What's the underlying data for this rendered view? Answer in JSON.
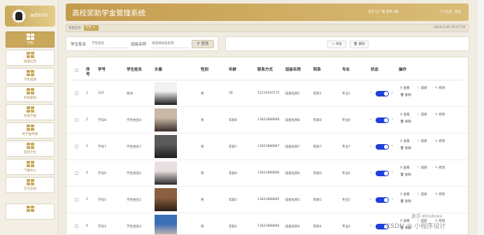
{
  "profile": {
    "name": "admin"
  },
  "sidebar": {
    "items": [
      {
        "label": "学院"
      },
      {
        "label": "班级信息"
      },
      {
        "label": "学生成绩"
      },
      {
        "label": "奖助类别"
      },
      {
        "label": "奖助学金"
      },
      {
        "label": "奖学金申请"
      },
      {
        "label": "获奖学生"
      },
      {
        "label": "下载中心"
      },
      {
        "label": "交流互动"
      },
      {
        "label": ""
      }
    ]
  },
  "header": {
    "title": "高校奖助学金管理系统",
    "weather": "北京  12° 晴  西风  2级",
    "links": [
      "个人信息",
      "退出"
    ]
  },
  "breadcrumb": {
    "home": "系统首页",
    "tab": "学生 ×",
    "time": "2024-3-25 20:57:18"
  },
  "search": {
    "fields": [
      {
        "label": "学生姓名",
        "placeholder": "学生姓名"
      },
      {
        "label": "班级名称",
        "placeholder": "请选择班级名称"
      }
    ],
    "button": "查找"
  },
  "actions": {
    "add": "添加",
    "delete": "删除"
  },
  "table": {
    "headers": [
      "序号",
      "学号",
      "学生姓名",
      "头像",
      "性别",
      "年龄",
      "联系方式",
      "班级名称",
      "院系",
      "专业",
      "状态",
      "操作"
    ],
    "rows": [
      {
        "no": "1",
        "id": "333",
        "name": "杨洋",
        "gender": "男",
        "age": "28",
        "phone": "15219187575",
        "class": "班级名称1",
        "dept": "院系1",
        "major": "专业1"
      },
      {
        "no": "2",
        "id": "学号8",
        "name": "学生姓名8",
        "gender": "男",
        "age": "年龄8",
        "phone": "13823888888",
        "class": "班级名称8",
        "dept": "院系8",
        "major": "专业8"
      },
      {
        "no": "3",
        "id": "学号7",
        "name": "学生姓名7",
        "gender": "男",
        "age": "年龄7",
        "phone": "13823888887",
        "class": "班级名称7",
        "dept": "院系7",
        "major": "专业7"
      },
      {
        "no": "4",
        "id": "学号6",
        "name": "学生姓名6",
        "gender": "男",
        "age": "年龄6",
        "phone": "13823888886",
        "class": "班级名称6",
        "dept": "院系6",
        "major": "专业6"
      },
      {
        "no": "5",
        "id": "学号5",
        "name": "学生姓名5",
        "gender": "男",
        "age": "年龄5",
        "phone": "13823888885",
        "class": "班级名称5",
        "dept": "院系5",
        "major": "专业5"
      },
      {
        "no": "6",
        "id": "学号4",
        "name": "学生姓名4",
        "gender": "男",
        "age": "年龄4",
        "phone": "13823888884",
        "class": "班级名称4",
        "dept": "院系4",
        "major": "专业4"
      }
    ],
    "ops": {
      "view": "查看",
      "grade": "成绩",
      "edit": "修改",
      "delete": "删除"
    }
  },
  "watermarks": [
    "激活 Windows",
    "CSDN @ 小程序设计"
  ],
  "colors": {
    "accent": "#c9a85b",
    "toggle": "#1f3fd8"
  },
  "icons": [
    "user-avatar-icon",
    "grid-icon",
    "search-icon",
    "plus-icon",
    "trash-icon",
    "eye-icon",
    "heart-icon",
    "edit-icon"
  ]
}
